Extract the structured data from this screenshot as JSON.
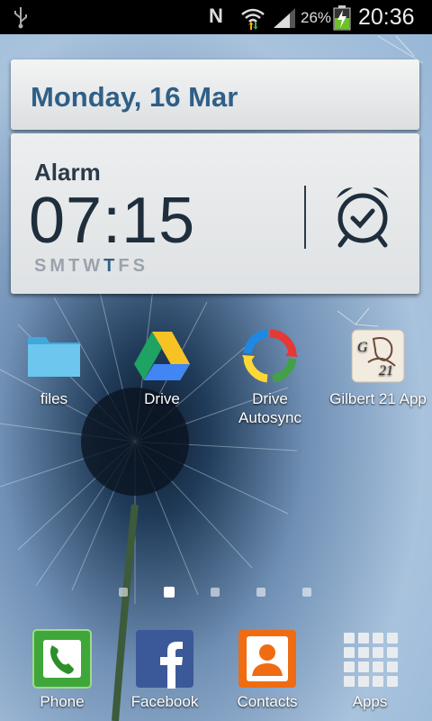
{
  "status_bar": {
    "icons": [
      "usb-icon",
      "nfc-icon",
      "wifi-icon",
      "signal-icon",
      "battery-charging-icon"
    ],
    "nfc_glyph": "N",
    "battery_percent": "26%",
    "time": "20:36"
  },
  "widget": {
    "date": "Monday, 16 Mar",
    "alarm_label": "Alarm",
    "alarm_time": "07:15",
    "days": [
      "S",
      "M",
      "T",
      "W",
      "T",
      "F",
      "S"
    ],
    "highlight_day_index": 4,
    "accent_color": "#2f5f88"
  },
  "apps": [
    {
      "label": "files",
      "icon": "folder-icon"
    },
    {
      "label": "Drive",
      "icon": "google-drive-icon"
    },
    {
      "label": "Drive Autosync",
      "icon": "drive-autosync-icon"
    },
    {
      "label": "Gilbert 21 App",
      "icon": "gilbert-21-icon",
      "icon_text": "G 21"
    }
  ],
  "pages": {
    "count": 5,
    "current_index": 1
  },
  "dock": [
    {
      "label": "Phone",
      "icon": "phone-icon"
    },
    {
      "label": "Facebook",
      "icon": "facebook-icon"
    },
    {
      "label": "Contacts",
      "icon": "contacts-icon"
    },
    {
      "label": "Apps",
      "icon": "apps-grid-icon"
    }
  ]
}
